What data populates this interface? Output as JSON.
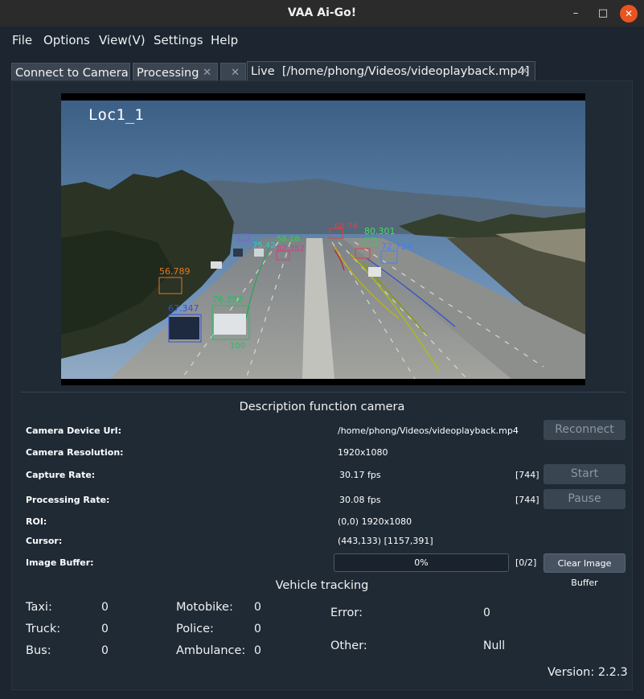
{
  "window": {
    "title": "VAA Ai-Go!",
    "min_symbol": "–",
    "max_symbol": "□",
    "close_symbol": "✕"
  },
  "menu": [
    "File",
    "Options",
    "View(V)",
    "Settings",
    "Help"
  ],
  "tabs": [
    {
      "label": "Connect to Camera...",
      "closable": false
    },
    {
      "label": "Processing",
      "closable": true
    },
    {
      "label": "",
      "closable": true
    },
    {
      "label": "Live  [/home/phong/Videos/videoplayback.mp4]",
      "closable": true,
      "active": true
    }
  ],
  "video": {
    "overlay_label": "Loc1_1",
    "detections": [
      {
        "label": "56.789",
        "color": "#e07a20"
      },
      {
        "label": "67.347",
        "color": "#3050e0"
      },
      {
        "label": "76.358",
        "color": "#20c060"
      },
      {
        "label": "80.301",
        "color": "#40e060"
      },
      {
        "label": "72.724",
        "color": "#4080ff"
      },
      {
        "label": "58.18",
        "color": "#30d050"
      },
      {
        "label": "82.352",
        "color": "#d04080"
      },
      {
        "label": "68.74",
        "color": "#e04040"
      },
      {
        "label": "75.42",
        "color": "#20d0d0"
      },
      {
        "label": "100",
        "color": "#20c060"
      }
    ]
  },
  "description": {
    "title": "Description function camera",
    "rows": {
      "url": {
        "label": "Camera Device Url:",
        "value": "/home/phong/Videos/videoplayback.mp4"
      },
      "resolution": {
        "label": "Camera Resolution:",
        "value": "1920x1080"
      },
      "capture": {
        "label": "Capture Rate:",
        "value": "30.17 fps",
        "count": "[744]"
      },
      "processing": {
        "label": "Processing Rate:",
        "value": "30.08 fps",
        "count": "[744]"
      },
      "roi": {
        "label": "ROI:",
        "value": "(0,0) 1920x1080"
      },
      "cursor": {
        "label": "Cursor:",
        "value": "(443,133) [1157,391]"
      },
      "buffer": {
        "label": "Image Buffer:",
        "progress_text": "0%",
        "progress": 0,
        "count": "[0/2]"
      }
    },
    "buttons": {
      "reconnect": "Reconnect",
      "start": "Start",
      "pause": "Pause",
      "clear_buffer": "Clear Image Buffer"
    }
  },
  "tracking": {
    "title": "Vehicle tracking",
    "taxi": {
      "label": "Taxi:",
      "value": "0"
    },
    "truck": {
      "label": "Truck:",
      "value": "0"
    },
    "bus": {
      "label": "Bus:",
      "value": "0"
    },
    "motobike": {
      "label": "Motobike:",
      "value": "0"
    },
    "police": {
      "label": "Police:",
      "value": "0"
    },
    "ambulance": {
      "label": "Ambulance:",
      "value": "0"
    },
    "error": {
      "label": "Error:",
      "value": "0"
    },
    "other": {
      "label": "Other:",
      "value": "Null"
    }
  },
  "version": "Version: 2.2.3"
}
